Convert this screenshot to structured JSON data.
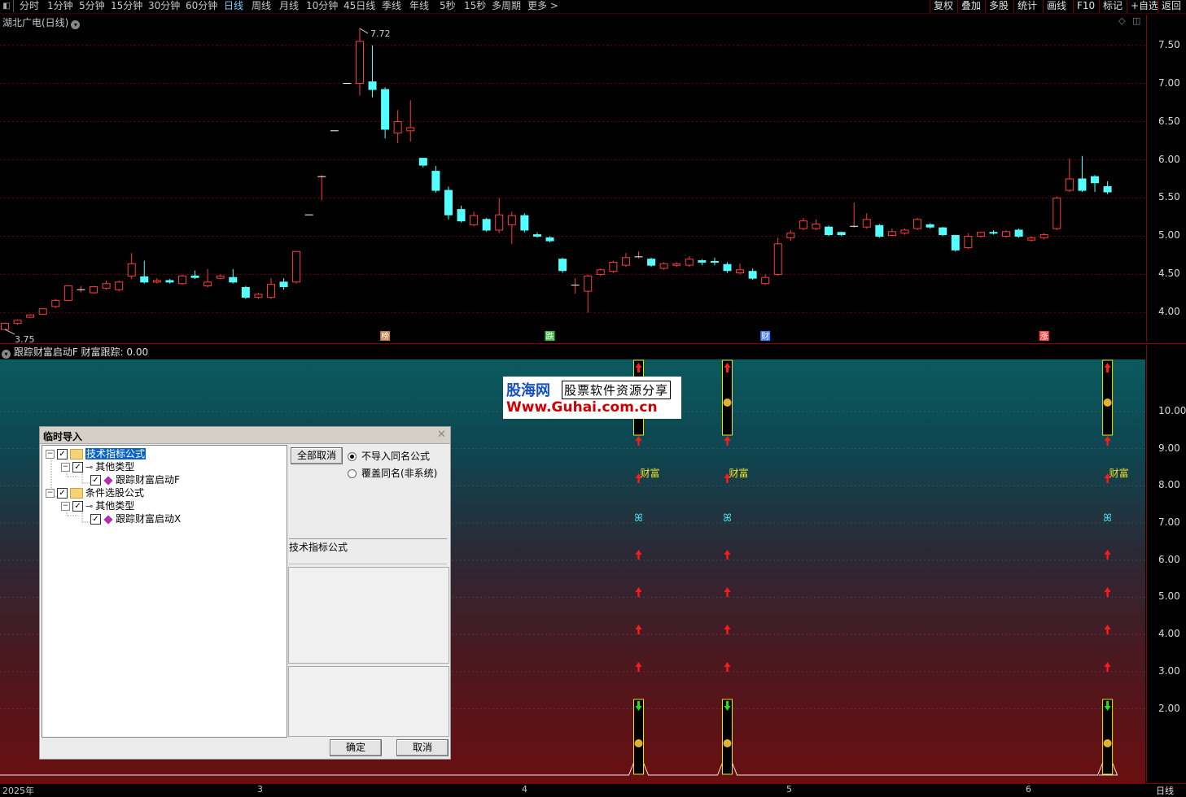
{
  "toolbar": {
    "periods": [
      "分时",
      "1分钟",
      "5分钟",
      "15分钟",
      "30分钟",
      "60分钟",
      "日线",
      "周线",
      "月线",
      "10分钟",
      "45日线",
      "季线",
      "年线",
      "5秒",
      "15秒",
      "多周期",
      "更多 >"
    ],
    "active_period": "日线",
    "right_items": [
      "复权",
      "叠加",
      "多股",
      "统计",
      "画线",
      "F10",
      "标记",
      "+自选",
      "返回"
    ]
  },
  "stock": {
    "title": "湖北广电(日线)"
  },
  "price_axis": {
    "labels": [
      "7.50",
      "7.00",
      "6.50",
      "6.00",
      "5.50",
      "5.00",
      "4.50",
      "4.00"
    ]
  },
  "price_marks": {
    "high": "7.72",
    "low": "3.75"
  },
  "event_tags": [
    "榜",
    "跌",
    "财",
    "涨"
  ],
  "indicator": {
    "title": "跟踪财富启动F  财富跟踪: 0.00",
    "signal_text": "财富"
  },
  "indicator_axis": {
    "labels": [
      "10.00",
      "9.00",
      "8.00",
      "7.00",
      "6.00",
      "5.00",
      "4.00",
      "3.00",
      "2.00"
    ]
  },
  "date_axis": {
    "labels": [
      "2025年",
      "3",
      "4",
      "5",
      "6"
    ],
    "period_label": "日线"
  },
  "watermark": {
    "brand": "股海网",
    "tagline": "股票软件资源分享",
    "url": "Www.Guhai.com.cn"
  },
  "dialog": {
    "title": "临时导入",
    "tree": [
      {
        "label": "技术指标公式",
        "level": 0,
        "type": "folder",
        "selected": true
      },
      {
        "label": "其他类型",
        "level": 1,
        "type": "group"
      },
      {
        "label": "跟踪财富启动F",
        "level": 2,
        "type": "formula"
      },
      {
        "label": "条件选股公式",
        "level": 0,
        "type": "folder"
      },
      {
        "label": "其他类型",
        "level": 1,
        "type": "group"
      },
      {
        "label": "跟踪财富启动X",
        "level": 2,
        "type": "formula"
      }
    ],
    "cancel_all_label": "全部取消",
    "radio_skip_label": "不导入同名公式",
    "radio_overwrite_label": "覆盖同名(非系统)",
    "selected_radio": "不导入同名公式",
    "group_label": "技术指标公式",
    "ok_label": "确定",
    "cancel_label": "取消"
  },
  "chart_data": {
    "type": "candlestick",
    "ylim": [
      3.6,
      7.9
    ],
    "up_color": "#ff3c3c",
    "down_color": "#54ffff",
    "candles": [
      [
        3.78,
        3.86,
        3.78,
        3.87
      ],
      [
        3.86,
        3.9,
        3.84,
        3.91
      ],
      [
        3.94,
        3.97,
        3.93,
        3.98
      ],
      [
        3.98,
        4.05,
        3.97,
        4.06
      ],
      [
        4.08,
        4.16,
        4.06,
        4.18
      ],
      [
        4.16,
        4.35,
        4.15,
        4.36
      ],
      [
        4.3,
        4.3,
        4.27,
        4.35
      ],
      [
        4.26,
        4.34,
        4.25,
        4.35
      ],
      [
        4.32,
        4.38,
        4.3,
        4.42
      ],
      [
        4.3,
        4.4,
        4.28,
        4.42
      ],
      [
        4.48,
        4.64,
        4.44,
        4.78
      ],
      [
        4.47,
        4.4,
        4.38,
        4.68
      ],
      [
        4.4,
        4.42,
        4.38,
        4.45
      ],
      [
        4.42,
        4.4,
        4.38,
        4.44
      ],
      [
        4.38,
        4.48,
        4.36,
        4.5
      ],
      [
        4.48,
        4.46,
        4.44,
        4.55
      ],
      [
        4.35,
        4.4,
        4.33,
        4.57
      ],
      [
        4.45,
        4.48,
        4.44,
        4.5
      ],
      [
        4.46,
        4.4,
        4.38,
        4.57
      ],
      [
        4.33,
        4.2,
        4.18,
        4.35
      ],
      [
        4.2,
        4.24,
        4.18,
        4.26
      ],
      [
        4.2,
        4.37,
        4.18,
        4.45
      ],
      [
        4.4,
        4.34,
        4.3,
        4.45
      ],
      [
        4.4,
        4.8,
        4.38,
        4.8
      ],
      [
        5.28,
        5.28,
        5.28,
        5.28
      ],
      [
        5.78,
        5.78,
        5.47,
        5.8
      ],
      [
        6.38,
        6.38,
        6.38,
        6.38
      ],
      [
        7.0,
        7.0,
        7.0,
        7.0
      ],
      [
        7.0,
        7.55,
        6.84,
        7.72
      ],
      [
        7.02,
        6.92,
        6.82,
        7.5
      ],
      [
        6.92,
        6.4,
        6.28,
        6.95
      ],
      [
        6.35,
        6.5,
        6.22,
        6.65
      ],
      [
        6.38,
        6.42,
        6.24,
        6.78
      ],
      [
        6.02,
        5.93,
        5.9,
        6.02
      ],
      [
        5.85,
        5.6,
        5.57,
        5.92
      ],
      [
        5.6,
        5.28,
        5.22,
        5.65
      ],
      [
        5.35,
        5.2,
        5.18,
        5.4
      ],
      [
        5.15,
        5.27,
        5.13,
        5.32
      ],
      [
        5.22,
        5.08,
        5.06,
        5.24
      ],
      [
        5.08,
        5.28,
        5.04,
        5.5
      ],
      [
        5.15,
        5.27,
        4.9,
        5.32
      ],
      [
        5.27,
        5.08,
        5.05,
        5.3
      ],
      [
        5.02,
        5.0,
        4.98,
        5.05
      ],
      [
        4.98,
        4.94,
        4.92,
        5.0
      ],
      [
        4.7,
        4.55,
        4.52,
        4.72
      ],
      [
        4.36,
        4.36,
        4.25,
        4.45
      ],
      [
        4.28,
        4.48,
        4.0,
        4.5
      ],
      [
        4.5,
        4.56,
        4.48,
        4.58
      ],
      [
        4.54,
        4.66,
        4.52,
        4.68
      ],
      [
        4.62,
        4.72,
        4.6,
        4.78
      ],
      [
        4.73,
        4.73,
        4.71,
        4.8
      ],
      [
        4.7,
        4.62,
        4.6,
        4.72
      ],
      [
        4.58,
        4.64,
        4.56,
        4.66
      ],
      [
        4.62,
        4.64,
        4.6,
        4.66
      ],
      [
        4.62,
        4.7,
        4.6,
        4.74
      ],
      [
        4.68,
        4.66,
        4.62,
        4.7
      ],
      [
        4.67,
        4.66,
        4.62,
        4.72
      ],
      [
        4.63,
        4.55,
        4.52,
        4.66
      ],
      [
        4.52,
        4.56,
        4.5,
        4.64
      ],
      [
        4.54,
        4.45,
        4.43,
        4.58
      ],
      [
        4.38,
        4.46,
        4.36,
        4.5
      ],
      [
        4.5,
        4.9,
        4.48,
        4.98
      ],
      [
        4.98,
        5.04,
        4.94,
        5.08
      ],
      [
        5.1,
        5.2,
        5.08,
        5.24
      ],
      [
        5.1,
        5.16,
        5.08,
        5.22
      ],
      [
        5.12,
        5.02,
        5.0,
        5.14
      ],
      [
        5.05,
        5.02,
        5.0,
        5.06
      ],
      [
        5.13,
        5.13,
        5.11,
        5.44
      ],
      [
        5.12,
        5.22,
        5.1,
        5.3
      ],
      [
        5.14,
        5.0,
        4.98,
        5.16
      ],
      [
        5.01,
        5.06,
        5.0,
        5.1
      ],
      [
        5.04,
        5.08,
        5.02,
        5.1
      ],
      [
        5.1,
        5.22,
        5.08,
        5.24
      ],
      [
        5.15,
        5.12,
        5.1,
        5.17
      ],
      [
        5.11,
        5.02,
        5.0,
        5.12
      ],
      [
        5.01,
        4.82,
        4.8,
        5.02
      ],
      [
        4.85,
        5.0,
        4.83,
        5.04
      ],
      [
        5.0,
        5.05,
        4.98,
        5.06
      ],
      [
        5.05,
        5.04,
        5.02,
        5.08
      ],
      [
        5.0,
        5.06,
        4.98,
        5.08
      ],
      [
        5.08,
        5.0,
        4.98,
        5.1
      ],
      [
        4.95,
        4.98,
        4.93,
        5.0
      ],
      [
        4.98,
        5.02,
        4.96,
        5.04
      ],
      [
        5.1,
        5.5,
        5.08,
        5.52
      ],
      [
        5.6,
        5.75,
        5.58,
        6.02
      ],
      [
        5.75,
        5.6,
        5.58,
        6.05
      ],
      [
        5.78,
        5.7,
        5.58,
        5.8
      ],
      [
        5.65,
        5.58,
        5.55,
        5.72
      ]
    ],
    "indicator": {
      "ylim": [
        0,
        11.4
      ],
      "signal_bars": [
        50,
        57,
        87
      ]
    }
  }
}
